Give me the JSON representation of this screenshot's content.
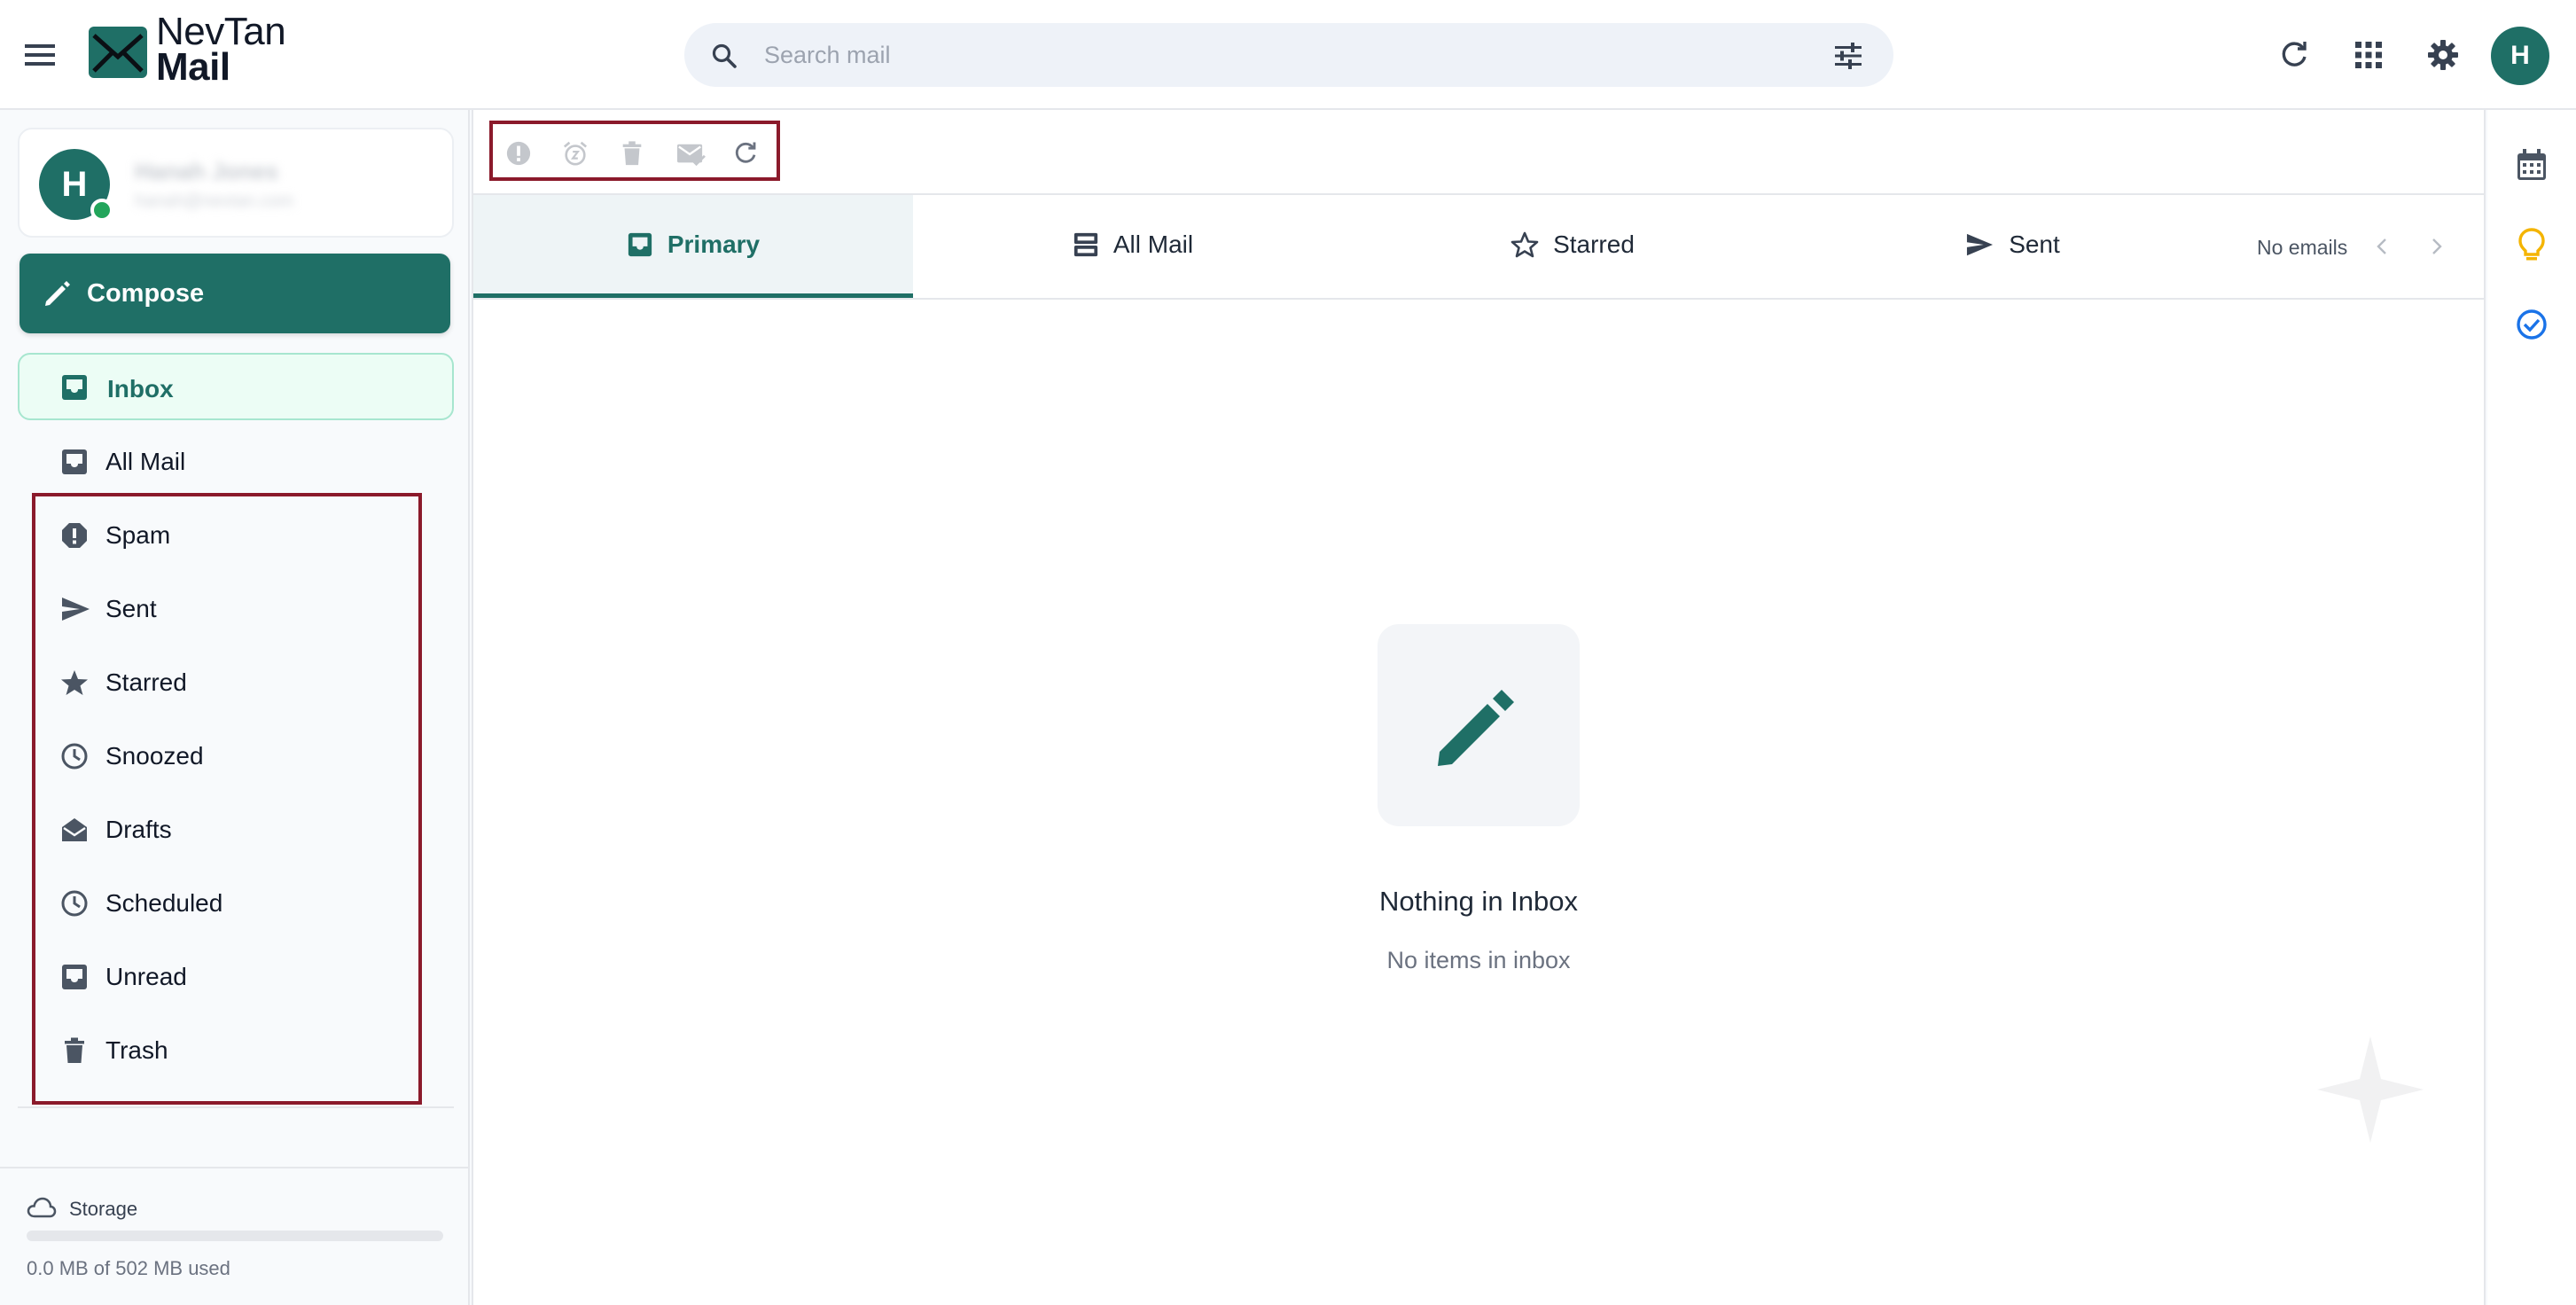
{
  "app": {
    "brand_line1": "NevTan",
    "brand_line2": "Mail"
  },
  "search": {
    "placeholder": "Search mail",
    "value": ""
  },
  "icons": {
    "menu": "menu-icon",
    "logo": "mail-envelope-logo",
    "search": "search-icon",
    "filter": "tune-icon",
    "refresh": "refresh-icon",
    "apps": "apps-grid-icon",
    "settings": "gear-icon"
  },
  "account": {
    "initial": "H",
    "name": "Hanah Jones",
    "email": "hanah@nevtan.com",
    "status": "online"
  },
  "compose": {
    "label": "Compose"
  },
  "nav": {
    "inbox": "Inbox",
    "all_mail": "All Mail",
    "spam": "Spam",
    "sent": "Sent",
    "starred": "Starred",
    "snoozed": "Snoozed",
    "drafts": "Drafts",
    "scheduled": "Scheduled",
    "unread": "Unread",
    "trash": "Trash"
  },
  "storage": {
    "label": "Storage",
    "used_text": "0.0 MB of 502 MB used",
    "used_fraction": 0.0
  },
  "toolbar": {
    "actions": [
      "report-spam",
      "snooze",
      "delete",
      "mark-read",
      "refresh"
    ]
  },
  "tabs": {
    "primary": "Primary",
    "all_mail": "All Mail",
    "starred": "Starred",
    "sent": "Sent"
  },
  "pager": {
    "text": "No emails"
  },
  "empty": {
    "title": "Nothing in Inbox",
    "subtitle": "No items in inbox"
  },
  "colors": {
    "brand": "#1f6f66",
    "highlight_border": "#8b1a2b",
    "active_nav_bg": "#ecfdf5",
    "online": "#22a55b",
    "keep": "#f4b400",
    "tasks": "#1a73e8"
  },
  "top_avatar": {
    "initial": "H"
  }
}
